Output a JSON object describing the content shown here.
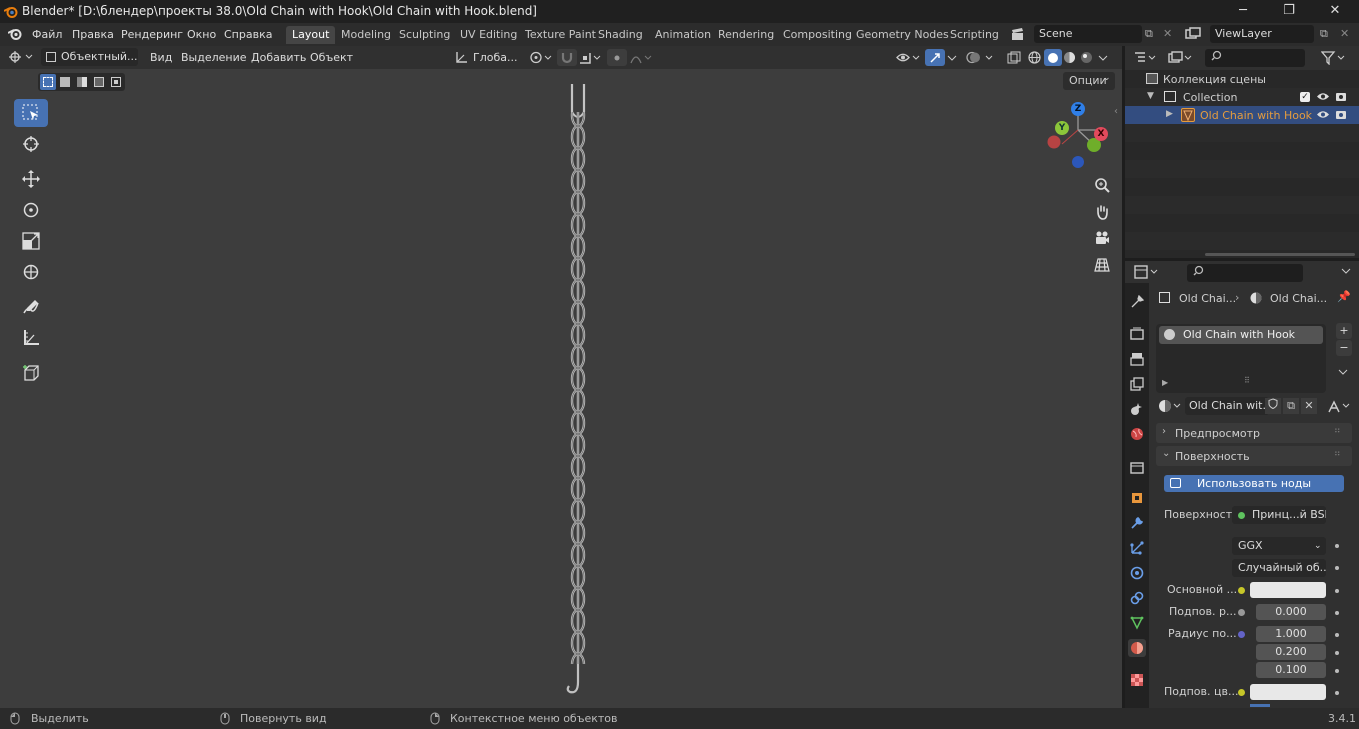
{
  "window": {
    "title": "Blender* [D:\\блендер\\проекты 38.0\\Old Chain with Hook\\Old Chain with Hook.blend]",
    "minimize": "─",
    "maximize": "❐",
    "close": "✕"
  },
  "menu": [
    "Файл",
    "Правка",
    "Рендеринг",
    "Окно",
    "Справка"
  ],
  "workspaces": [
    "Layout",
    "Modeling",
    "Sculpting",
    "UV Editing",
    "Texture Paint",
    "Shading",
    "Animation",
    "Rendering",
    "Compositing",
    "Geometry Nodes",
    "Scripting"
  ],
  "scene": "Scene",
  "view_layer": "ViewLayer",
  "viewport_header": {
    "mode": "Объектный...",
    "menus": [
      "Вид",
      "Выделение",
      "Добавить",
      "Объект"
    ],
    "orientation": "Глоба...",
    "options": "Опции"
  },
  "gizmo": {
    "x": "X",
    "y": "Y",
    "z": "Z"
  },
  "outliner": {
    "scene_collection": "Коллекция сцены",
    "collection": "Collection",
    "object": "Old Chain with Hook"
  },
  "properties": {
    "breadcrumb_object": "Old Chai...",
    "breadcrumb_material": "Old Chai...",
    "slot_name": "Old Chain with Hook",
    "material_field": "Old Chain wit...",
    "panel_preview": "Предпросмотр",
    "panel_surface": "Поверхность",
    "use_nodes": "Использовать ноды",
    "surface_label": "Поверхность",
    "surface_value": "Принц...й BSDF",
    "distribution": "GGX",
    "subsurface_method": "Случайный об...",
    "base_color_label": "Основной ...",
    "subsurface_label": "Подпов. р...",
    "subsurface_value": "0.000",
    "radius_label": "Радиус по...",
    "radius_values": [
      "1.000",
      "0.200",
      "0.100"
    ],
    "subsurface_color_label": "Подпов. цв..."
  },
  "colors": {
    "accent": "#4772b3",
    "active_object": "#e59c3e",
    "base_color": "#e8e8e8"
  },
  "status": {
    "select": "Выделить",
    "rotate": "Повернуть вид",
    "context": "Контекстное меню объектов",
    "version": "3.4.1"
  }
}
